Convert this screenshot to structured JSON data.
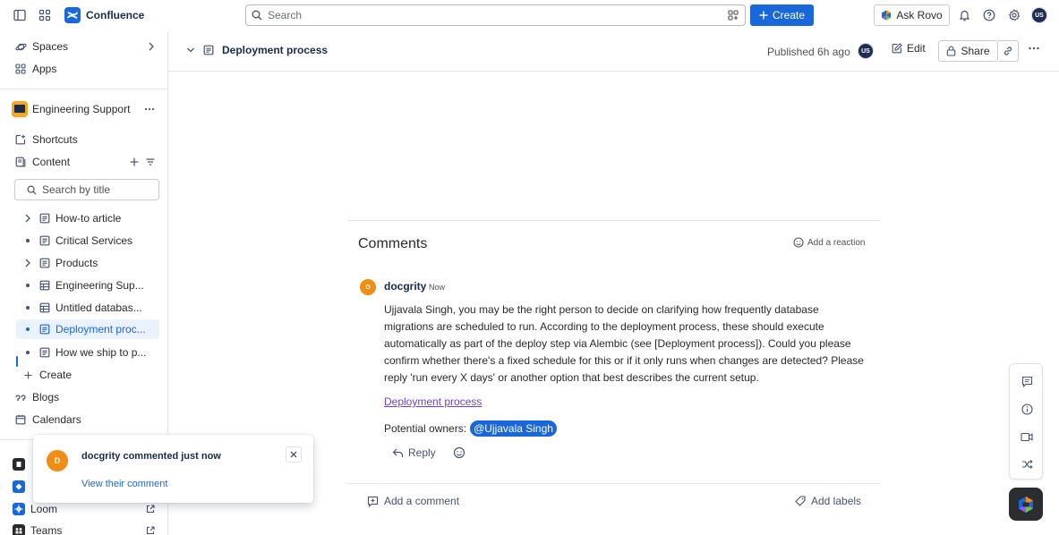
{
  "topbar": {
    "app_name": "Confluence",
    "search_placeholder": "Search",
    "create_label": "Create",
    "ask_rovo_label": "Ask Rovo",
    "user_initials": "US"
  },
  "sidebar": {
    "spaces_label": "Spaces",
    "apps_label": "Apps",
    "space_name": "Engineering Support",
    "shortcuts_label": "Shortcuts",
    "content_label": "Content",
    "search_placeholder": "Search by title",
    "tree": [
      {
        "label": "How-to article",
        "lead": "chevron",
        "icon": "page"
      },
      {
        "label": "Critical Services",
        "lead": "dot",
        "icon": "page"
      },
      {
        "label": "Products",
        "lead": "chevron",
        "icon": "page"
      },
      {
        "label": "Engineering Sup...",
        "lead": "dot",
        "icon": "database"
      },
      {
        "label": "Untitled databas...",
        "lead": "dot",
        "icon": "database"
      },
      {
        "label": "Deployment proc...",
        "lead": "dot",
        "icon": "page",
        "active": true
      },
      {
        "label": "How we ship to p...",
        "lead": "dot",
        "icon": "page"
      }
    ],
    "create_label": "Create",
    "blogs_label": "Blogs",
    "calendars_label": "Calendars",
    "apps_list": [
      {
        "label": "Loom"
      },
      {
        "label": "Teams"
      }
    ]
  },
  "page_header": {
    "title": "Deployment process",
    "published": "Published 6h ago",
    "owner_initials": "US",
    "edit_label": "Edit",
    "share_label": "Share"
  },
  "comments": {
    "title": "Comments",
    "add_reaction": "Add a reaction",
    "items": [
      {
        "author": "docgrity",
        "avatar_initial": "D",
        "time": "Now",
        "body_lines": [
          "Ujjavala Singh, you may be the right person to decide on clarifying how frequently database",
          "migrations are scheduled to run. According to the deployment process, these should execute",
          "automatically as part of the deploy step via Alembic (see [Deployment process]). Could you please",
          "confirm whether there's a fixed schedule for this or if it only runs when changes are detected? Please",
          "reply 'run every X days' or another option that best describes the current setup."
        ],
        "link_text": "Deployment process",
        "owners_label": "Potential owners:",
        "mention": "@Ujjavala Singh",
        "reply_label": "Reply"
      }
    ],
    "add_comment": "Add a comment",
    "add_labels": "Add labels"
  },
  "toast": {
    "avatar_initial": "D",
    "title": "docgrity commented just now",
    "link": "View their comment"
  },
  "colors": {
    "brand_blue": "#1868db",
    "avatar_orange": "#f18d13",
    "link_purple": "#6e43c7",
    "active_bg": "#e9f2fe"
  }
}
